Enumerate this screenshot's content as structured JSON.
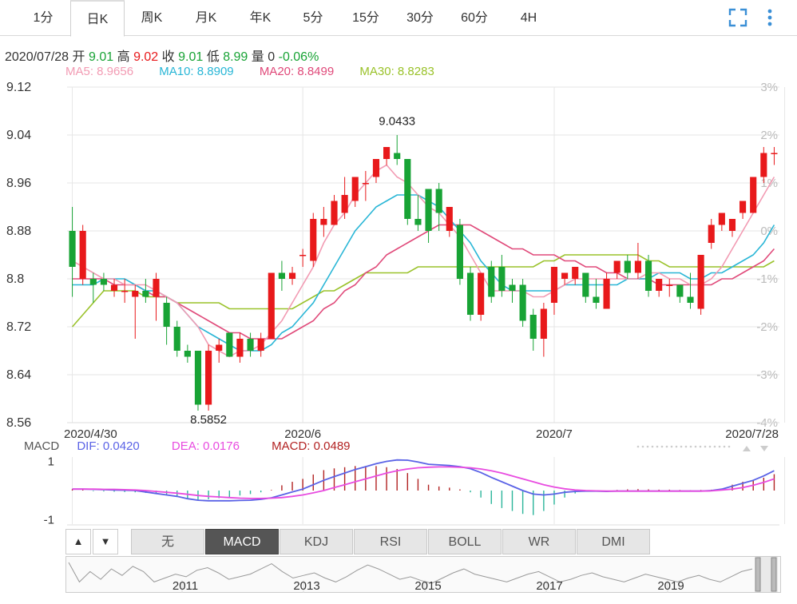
{
  "tabs": [
    "1分",
    "日K",
    "周K",
    "月K",
    "年K",
    "5分",
    "15分",
    "30分",
    "60分",
    "4H"
  ],
  "active_tab": "日K",
  "icons": {
    "fullscreen": "fullscreen-icon",
    "more": "more-vertical-icon"
  },
  "ohlc": {
    "date": "2020/07/28",
    "open_label": "开",
    "open": "9.01",
    "high_label": "高",
    "high": "9.02",
    "close_label": "收",
    "close": "9.01",
    "low_label": "低",
    "low": "8.99",
    "vol_label": "量",
    "vol": "0",
    "change": "-0.06%"
  },
  "ma": [
    {
      "label": "MA5: 8.9656",
      "color": "#f29bb3"
    },
    {
      "label": "MA10: 8.8909",
      "color": "#29b6d6"
    },
    {
      "label": "MA20: 8.8499",
      "color": "#e04a7a"
    },
    {
      "label": "MA30: 8.8283",
      "color": "#9ac22a"
    }
  ],
  "colors": {
    "up": "#e8191b",
    "down": "#18a335",
    "macd_up": "#b22222",
    "macd_down": "#2bb59a",
    "dif": "#5a62e6",
    "dea": "#e84be0",
    "grid": "#e6e6e6",
    "axis_text": "#333",
    "pct_text": "#bbb"
  },
  "chart_data": {
    "type": "candlestick",
    "y_ticks": [
      "9.12",
      "9.04",
      "8.96",
      "8.88",
      "8.8",
      "8.72",
      "8.64",
      "8.56"
    ],
    "ylim": [
      8.56,
      9.12
    ],
    "pct_ticks": [
      "3%",
      "2%",
      "1%",
      "0%",
      "-1%",
      "-2%",
      "-3%",
      "-4%"
    ],
    "x_labels": [
      {
        "label": "2020/4/30",
        "index": 0
      },
      {
        "label": "2020/6",
        "index": 22
      },
      {
        "label": "2020/7",
        "index": 46
      },
      {
        "label": "2020/7/28",
        "index": 68
      }
    ],
    "annotations": [
      {
        "label": "9.0433",
        "index": 31,
        "value": 9.0433,
        "pos": "above"
      },
      {
        "label": "8.5852",
        "index": 13,
        "value": 8.5852,
        "pos": "below"
      }
    ],
    "candles": [
      [
        8.88,
        8.82,
        8.92,
        8.77
      ],
      [
        8.8,
        8.88,
        8.89,
        8.79
      ],
      [
        8.8,
        8.79,
        8.81,
        8.76
      ],
      [
        8.8,
        8.79,
        8.81,
        8.78
      ],
      [
        8.78,
        8.79,
        8.8,
        8.77
      ],
      [
        8.78,
        8.78,
        8.8,
        8.76
      ],
      [
        8.77,
        8.78,
        8.79,
        8.7
      ],
      [
        8.78,
        8.77,
        8.8,
        8.76
      ],
      [
        8.77,
        8.8,
        8.81,
        8.73
      ],
      [
        8.76,
        8.72,
        8.77,
        8.69
      ],
      [
        8.72,
        8.68,
        8.73,
        8.67
      ],
      [
        8.68,
        8.67,
        8.69,
        8.66
      ],
      [
        8.68,
        8.59,
        8.68,
        8.58
      ],
      [
        8.59,
        8.68,
        8.69,
        8.58
      ],
      [
        8.68,
        8.69,
        8.7,
        8.66
      ],
      [
        8.71,
        8.67,
        8.71,
        8.67
      ],
      [
        8.67,
        8.7,
        8.71,
        8.66
      ],
      [
        8.7,
        8.68,
        8.71,
        8.67
      ],
      [
        8.68,
        8.7,
        8.71,
        8.67
      ],
      [
        8.7,
        8.81,
        8.81,
        8.7
      ],
      [
        8.81,
        8.8,
        8.83,
        8.78
      ],
      [
        8.8,
        8.81,
        8.82,
        8.79
      ],
      [
        8.84,
        8.84,
        8.85,
        8.82
      ],
      [
        8.83,
        8.9,
        8.91,
        8.82
      ],
      [
        8.89,
        8.9,
        8.92,
        8.87
      ],
      [
        8.89,
        8.93,
        8.94,
        8.89
      ],
      [
        8.91,
        8.94,
        8.97,
        8.9
      ],
      [
        8.93,
        8.97,
        8.97,
        8.92
      ],
      [
        8.96,
        8.96,
        8.98,
        8.93
      ],
      [
        8.97,
        9.0,
        9.0,
        8.96
      ],
      [
        9.0,
        9.02,
        9.02,
        8.99
      ],
      [
        9.01,
        9.0,
        9.04,
        8.99
      ],
      [
        9.0,
        8.9,
        9.0,
        8.89
      ],
      [
        8.9,
        8.89,
        8.94,
        8.88
      ],
      [
        8.95,
        8.88,
        8.95,
        8.86
      ],
      [
        8.95,
        8.91,
        8.96,
        8.88
      ],
      [
        8.88,
        8.92,
        8.92,
        8.87
      ],
      [
        8.89,
        8.8,
        8.9,
        8.79
      ],
      [
        8.81,
        8.74,
        8.82,
        8.73
      ],
      [
        8.74,
        8.81,
        8.81,
        8.73
      ],
      [
        8.82,
        8.77,
        8.83,
        8.76
      ],
      [
        8.82,
        8.78,
        8.84,
        8.77
      ],
      [
        8.79,
        8.78,
        8.8,
        8.76
      ],
      [
        8.79,
        8.73,
        8.8,
        8.72
      ],
      [
        8.74,
        8.7,
        8.75,
        8.68
      ],
      [
        8.7,
        8.75,
        8.76,
        8.67
      ],
      [
        8.76,
        8.82,
        8.82,
        8.74
      ],
      [
        8.8,
        8.81,
        8.81,
        8.79
      ],
      [
        8.8,
        8.82,
        8.82,
        8.79
      ],
      [
        8.81,
        8.77,
        8.81,
        8.76
      ],
      [
        8.77,
        8.76,
        8.8,
        8.75
      ],
      [
        8.75,
        8.8,
        8.81,
        8.75
      ],
      [
        8.81,
        8.83,
        8.83,
        8.8
      ],
      [
        8.83,
        8.81,
        8.84,
        8.8
      ],
      [
        8.81,
        8.83,
        8.86,
        8.8
      ],
      [
        8.83,
        8.78,
        8.84,
        8.77
      ],
      [
        8.78,
        8.8,
        8.8,
        8.77
      ],
      [
        8.79,
        8.79,
        8.8,
        8.77
      ],
      [
        8.79,
        8.77,
        8.79,
        8.76
      ],
      [
        8.77,
        8.76,
        8.81,
        8.75
      ],
      [
        8.75,
        8.84,
        8.84,
        8.74
      ],
      [
        8.86,
        8.89,
        8.9,
        8.85
      ],
      [
        8.89,
        8.91,
        8.91,
        8.88
      ],
      [
        8.88,
        8.9,
        8.9,
        8.87
      ],
      [
        8.91,
        8.93,
        8.93,
        8.9
      ],
      [
        8.91,
        8.97,
        8.97,
        8.91
      ],
      [
        8.97,
        9.01,
        9.02,
        8.96
      ],
      [
        9.01,
        9.01,
        9.02,
        8.99
      ]
    ],
    "ma5": [
      8.83,
      8.82,
      8.81,
      8.8,
      8.8,
      8.79,
      8.79,
      8.79,
      8.78,
      8.77,
      8.76,
      8.74,
      8.72,
      8.69,
      8.68,
      8.67,
      8.68,
      8.68,
      8.69,
      8.71,
      8.73,
      8.76,
      8.79,
      8.82,
      8.86,
      8.89,
      8.91,
      8.94,
      8.96,
      8.98,
      8.99,
      8.97,
      8.96,
      8.94,
      8.92,
      8.91,
      8.89,
      8.87,
      8.84,
      8.81,
      8.78,
      8.78,
      8.78,
      8.78,
      8.77,
      8.77,
      8.78,
      8.79,
      8.8,
      8.8,
      8.8,
      8.8,
      8.8,
      8.8,
      8.8,
      8.81,
      8.81,
      8.8,
      8.8,
      8.79,
      8.79,
      8.8,
      8.82,
      8.85,
      8.88,
      8.91,
      8.94,
      8.97
    ],
    "ma10": [
      8.79,
      8.79,
      8.79,
      8.8,
      8.8,
      8.8,
      8.79,
      8.78,
      8.78,
      8.77,
      8.76,
      8.74,
      8.72,
      8.71,
      8.7,
      8.69,
      8.68,
      8.68,
      8.68,
      8.69,
      8.71,
      8.72,
      8.74,
      8.76,
      8.79,
      8.82,
      8.85,
      8.88,
      8.9,
      8.92,
      8.93,
      8.94,
      8.94,
      8.94,
      8.93,
      8.92,
      8.9,
      8.88,
      8.86,
      8.83,
      8.81,
      8.79,
      8.78,
      8.78,
      8.78,
      8.78,
      8.78,
      8.79,
      8.79,
      8.79,
      8.79,
      8.79,
      8.79,
      8.8,
      8.8,
      8.8,
      8.81,
      8.81,
      8.81,
      8.8,
      8.8,
      8.81,
      8.81,
      8.82,
      8.83,
      8.84,
      8.86,
      8.89
    ],
    "ma20": [
      8.8,
      8.8,
      8.8,
      8.8,
      8.79,
      8.79,
      8.79,
      8.78,
      8.77,
      8.77,
      8.76,
      8.75,
      8.74,
      8.73,
      8.72,
      8.71,
      8.71,
      8.7,
      8.7,
      8.7,
      8.7,
      8.71,
      8.72,
      8.73,
      8.75,
      8.76,
      8.78,
      8.79,
      8.81,
      8.82,
      8.84,
      8.85,
      8.86,
      8.87,
      8.88,
      8.89,
      8.89,
      8.89,
      8.89,
      8.88,
      8.87,
      8.86,
      8.85,
      8.85,
      8.84,
      8.84,
      8.84,
      8.83,
      8.83,
      8.82,
      8.82,
      8.81,
      8.81,
      8.8,
      8.8,
      8.8,
      8.79,
      8.79,
      8.79,
      8.79,
      8.79,
      8.79,
      8.8,
      8.8,
      8.81,
      8.82,
      8.83,
      8.85
    ],
    "ma30": [
      8.72,
      8.74,
      8.76,
      8.78,
      8.78,
      8.78,
      8.78,
      8.77,
      8.77,
      8.77,
      8.76,
      8.76,
      8.76,
      8.76,
      8.76,
      8.75,
      8.75,
      8.75,
      8.75,
      8.75,
      8.75,
      8.75,
      8.76,
      8.77,
      8.78,
      8.78,
      8.79,
      8.8,
      8.81,
      8.81,
      8.81,
      8.81,
      8.81,
      8.82,
      8.82,
      8.82,
      8.82,
      8.82,
      8.82,
      8.82,
      8.82,
      8.82,
      8.82,
      8.82,
      8.82,
      8.83,
      8.83,
      8.84,
      8.84,
      8.84,
      8.84,
      8.84,
      8.84,
      8.84,
      8.84,
      8.83,
      8.83,
      8.82,
      8.82,
      8.82,
      8.82,
      8.82,
      8.82,
      8.82,
      8.82,
      8.82,
      8.82,
      8.83
    ]
  },
  "macd": {
    "title": "MACD",
    "dif_label": "DIF: 0.0420",
    "dea_label": "DEA: 0.0176",
    "macd_label": "MACD: 0.0489",
    "y_ticks": [
      "1",
      "-1"
    ],
    "ylim": [
      -1.15,
      1.15
    ],
    "dif": [
      0.05,
      0.05,
      0.04,
      0.03,
      0.02,
      0.01,
      0.0,
      -0.05,
      -0.1,
      -0.15,
      -0.2,
      -0.28,
      -0.33,
      -0.35,
      -0.35,
      -0.35,
      -0.34,
      -0.33,
      -0.3,
      -0.25,
      -0.15,
      -0.05,
      0.05,
      0.2,
      0.35,
      0.48,
      0.6,
      0.72,
      0.82,
      0.92,
      1.0,
      1.05,
      1.04,
      0.98,
      0.9,
      0.88,
      0.86,
      0.82,
      0.75,
      0.62,
      0.45,
      0.3,
      0.15,
      0.0,
      -0.12,
      -0.15,
      -0.12,
      -0.06,
      -0.03,
      -0.02,
      -0.02,
      -0.03,
      -0.02,
      -0.02,
      -0.02,
      -0.02,
      -0.02,
      -0.02,
      -0.02,
      -0.02,
      -0.02,
      0.0,
      0.05,
      0.15,
      0.25,
      0.35,
      0.5,
      0.68
    ],
    "dea": [
      0.05,
      0.05,
      0.05,
      0.04,
      0.04,
      0.03,
      0.02,
      0.0,
      -0.03,
      -0.06,
      -0.09,
      -0.13,
      -0.17,
      -0.2,
      -0.22,
      -0.24,
      -0.26,
      -0.27,
      -0.27,
      -0.26,
      -0.24,
      -0.2,
      -0.15,
      -0.08,
      0.0,
      0.1,
      0.2,
      0.3,
      0.4,
      0.5,
      0.6,
      0.68,
      0.74,
      0.78,
      0.8,
      0.81,
      0.81,
      0.8,
      0.78,
      0.74,
      0.68,
      0.6,
      0.5,
      0.4,
      0.3,
      0.2,
      0.12,
      0.06,
      0.02,
      0.0,
      -0.01,
      -0.02,
      -0.02,
      -0.02,
      -0.02,
      -0.02,
      -0.02,
      -0.02,
      -0.02,
      -0.02,
      -0.02,
      -0.01,
      0.02,
      0.05,
      0.1,
      0.18,
      0.28,
      0.4
    ],
    "hist": [
      0.05,
      0.05,
      -0.02,
      -0.03,
      -0.04,
      -0.05,
      -0.06,
      -0.08,
      -0.12,
      -0.15,
      -0.2,
      -0.28,
      -0.32,
      -0.3,
      -0.26,
      -0.22,
      -0.17,
      -0.12,
      -0.06,
      0.02,
      0.18,
      0.3,
      0.4,
      0.55,
      0.7,
      0.76,
      0.8,
      0.84,
      0.84,
      0.84,
      0.8,
      0.74,
      0.6,
      0.4,
      0.2,
      0.14,
      0.1,
      0.04,
      -0.06,
      -0.24,
      -0.46,
      -0.6,
      -0.7,
      -0.8,
      -0.84,
      -0.7,
      -0.48,
      -0.24,
      -0.1,
      -0.04,
      -0.02,
      -0.02,
      0.02,
      0.04,
      0.05,
      0.04,
      0.03,
      0.03,
      0.02,
      0.01,
      0.02,
      0.03,
      0.06,
      0.2,
      0.3,
      0.34,
      0.44,
      0.56
    ]
  },
  "nav_buttons": {
    "prev": "▲",
    "next": "▼"
  },
  "indicators": [
    "无",
    "MACD",
    "KDJ",
    "RSI",
    "BOLL",
    "WR",
    "DMI"
  ],
  "active_indicator": "MACD",
  "navigator": {
    "years": [
      "2011",
      "2013",
      "2015",
      "2017",
      "2019"
    ],
    "series": [
      8.85,
      8.7,
      8.78,
      8.72,
      8.8,
      8.75,
      8.82,
      8.78,
      8.7,
      8.73,
      8.76,
      8.74,
      8.79,
      8.81,
      8.77,
      8.72,
      8.74,
      8.76,
      8.8,
      8.84,
      8.78,
      8.73,
      8.75,
      8.77,
      8.73,
      8.7,
      8.74,
      8.79,
      8.83,
      8.8,
      8.76,
      8.72,
      8.74,
      8.71,
      8.69,
      8.73,
      8.77,
      8.8,
      8.76,
      8.74,
      8.72,
      8.7,
      8.73,
      8.76,
      8.78,
      8.74,
      8.7,
      8.72,
      8.75,
      8.77,
      8.74,
      8.72,
      8.7,
      8.73,
      8.76,
      8.74,
      8.72,
      8.7,
      8.73,
      8.75,
      8.72,
      8.7,
      8.74,
      8.78,
      8.8
    ]
  }
}
